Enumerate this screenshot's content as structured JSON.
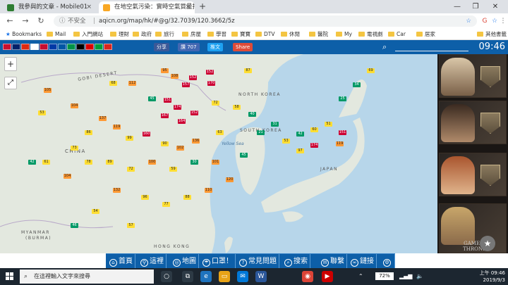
{
  "browser": {
    "tabs": [
      {
        "title": "我參與的文章 - Mobile01",
        "close": "×",
        "favicon_color": "#2e7d32",
        "active": false
      },
      {
        "title": "在地空氣污染：實時空氣質量指數",
        "close": "×",
        "favicon_color": "#f9a825",
        "active": true
      }
    ],
    "new_tab": "+",
    "window_controls": [
      "—",
      "❐",
      "✕"
    ],
    "address": {
      "info_icon": "ⓘ",
      "security": "不安全",
      "separator": "|",
      "url": "aqicn.org/map/hk/#@g/32.7039/120.3662/5z",
      "star": "☆"
    },
    "nav": {
      "back": "←",
      "forward": "→",
      "reload": "↻"
    },
    "extensions": [
      "G",
      "☆",
      "⋮"
    ],
    "bookmarks": [
      "Bookmarks",
      "Mail",
      "入門網站",
      "理財",
      "政府",
      "旅行",
      "房屋",
      "學習",
      "寶寶",
      "DTV",
      "休閒",
      "醫院",
      "My",
      "電視劇",
      "Car",
      "居家",
      "其他書籤"
    ]
  },
  "site_header": {
    "flags": [
      "#c8102e",
      "#012169",
      "#de2910",
      "#fff",
      "#c60c30",
      "#0039a6",
      "#0055a4",
      "#009246",
      "#000",
      "#dd0000",
      "#009c3b",
      "#da251d"
    ],
    "share": [
      {
        "label": "分享",
        "color": "#3b5998"
      },
      {
        "label": "讚 707",
        "color": "#4267b2"
      },
      {
        "label": "推文",
        "color": "#1da1f2"
      },
      {
        "label": "Share",
        "color": "#dd4b39"
      }
    ],
    "search_icon": "⌕",
    "time": "09:46"
  },
  "map": {
    "labels": {
      "gobi": "GOBI DESERT",
      "china": "CHINA",
      "nkorea": "NORTH KOREA",
      "skorea": "SOUTH KOREA",
      "japan": "JAPAN",
      "myanmar": "MYANMAR",
      "burma": "(BURMA)",
      "yellowsea": "Yellow Sea",
      "hongkong": "HONG KONG"
    },
    "zoom_in": "+",
    "zoom_out": "−",
    "fullscreen": "⤢",
    "aqi_colors": {
      "good": "#009966",
      "moderate": "#ffde33",
      "sensitive": "#ff9933",
      "unhealthy": "#cc0033"
    },
    "stations": [
      {
        "v": "95",
        "c": "o"
      },
      {
        "v": "108",
        "c": "o"
      },
      {
        "v": "152",
        "c": "r"
      },
      {
        "v": "87",
        "c": "y"
      },
      {
        "v": "105",
        "c": "o"
      },
      {
        "v": "68",
        "c": "y"
      },
      {
        "v": "112",
        "c": "o"
      },
      {
        "v": "157",
        "c": "r"
      },
      {
        "v": "170",
        "c": "r"
      },
      {
        "v": "152",
        "c": "r"
      },
      {
        "v": "104",
        "c": "o"
      },
      {
        "v": "53",
        "c": "y"
      },
      {
        "v": "45",
        "c": "g"
      },
      {
        "v": "151",
        "c": "r"
      },
      {
        "v": "174",
        "c": "r"
      },
      {
        "v": "167",
        "c": "r"
      },
      {
        "v": "164",
        "c": "r"
      },
      {
        "v": "152",
        "c": "r"
      },
      {
        "v": "72",
        "c": "y"
      },
      {
        "v": "58",
        "c": "y"
      },
      {
        "v": "137",
        "c": "o"
      },
      {
        "v": "119",
        "c": "o"
      },
      {
        "v": "86",
        "c": "y"
      },
      {
        "v": "99",
        "c": "y"
      },
      {
        "v": "160",
        "c": "r"
      },
      {
        "v": "90",
        "c": "y"
      },
      {
        "v": "102",
        "c": "o"
      },
      {
        "v": "136",
        "c": "o"
      },
      {
        "v": "63",
        "c": "y"
      },
      {
        "v": "40",
        "c": "g"
      },
      {
        "v": "21",
        "c": "g"
      },
      {
        "v": "31",
        "c": "g"
      },
      {
        "v": "53",
        "c": "y"
      },
      {
        "v": "42",
        "c": "g"
      },
      {
        "v": "60",
        "c": "y"
      },
      {
        "v": "51",
        "c": "y"
      },
      {
        "v": "151",
        "c": "r"
      },
      {
        "v": "119",
        "c": "o"
      },
      {
        "v": "174",
        "c": "r"
      },
      {
        "v": "97",
        "c": "y"
      },
      {
        "v": "73",
        "c": "y"
      },
      {
        "v": "78",
        "c": "y"
      },
      {
        "v": "104",
        "c": "o"
      },
      {
        "v": "61",
        "c": "y"
      },
      {
        "v": "42",
        "c": "g"
      },
      {
        "v": "89",
        "c": "y"
      },
      {
        "v": "72",
        "c": "y"
      },
      {
        "v": "100",
        "c": "o"
      },
      {
        "v": "59",
        "c": "y"
      },
      {
        "v": "30",
        "c": "g"
      },
      {
        "v": "101",
        "c": "o"
      },
      {
        "v": "45",
        "c": "g"
      },
      {
        "v": "132",
        "c": "o"
      },
      {
        "v": "96",
        "c": "y"
      },
      {
        "v": "77",
        "c": "y"
      },
      {
        "v": "88",
        "c": "y"
      },
      {
        "v": "110",
        "c": "o"
      },
      {
        "v": "120",
        "c": "o"
      },
      {
        "v": "25",
        "c": "g"
      },
      {
        "v": "34",
        "c": "g"
      },
      {
        "v": "69",
        "c": "y"
      },
      {
        "v": "54",
        "c": "y"
      },
      {
        "v": "46",
        "c": "g"
      },
      {
        "v": "57",
        "c": "y"
      }
    ]
  },
  "ad": {
    "logo_line1": "GAME OF",
    "logo_line2": "THRONES",
    "star_button": "★"
  },
  "bottom_nav": [
    {
      "label": "首頁",
      "icon": "⌂"
    },
    {
      "label": "這裡",
      "icon": "⚲"
    },
    {
      "label": "地圖",
      "icon": "◎"
    },
    {
      "label": "口罩！",
      "icon": "☂"
    },
    {
      "label": "常見問題",
      "icon": "?"
    },
    {
      "label": "搜索",
      "icon": "⌕"
    },
    {
      "label": "聯繫",
      "icon": "✉"
    },
    {
      "label": "鏈接",
      "icon": "∞"
    },
    {
      "label": "",
      "icon": "⚙"
    }
  ],
  "taskbar": {
    "search_placeholder": "在這裡輸入文字來搜尋",
    "battery": "72%",
    "time": "上午 09:46",
    "date": "2019/9/3",
    "apps": [
      {
        "icon": "○",
        "color": "#2d3a45"
      },
      {
        "icon": "⧉",
        "color": "#2d3a45"
      },
      {
        "icon": "e",
        "color": "#1e73be"
      },
      {
        "icon": "▭",
        "color": "#e8a317"
      },
      {
        "icon": "✉",
        "color": "#0078d7"
      },
      {
        "icon": "W",
        "color": "#2b579a"
      },
      {
        "icon": "◉",
        "color": "#db4437"
      },
      {
        "icon": "▶",
        "color": "#c00"
      }
    ]
  }
}
